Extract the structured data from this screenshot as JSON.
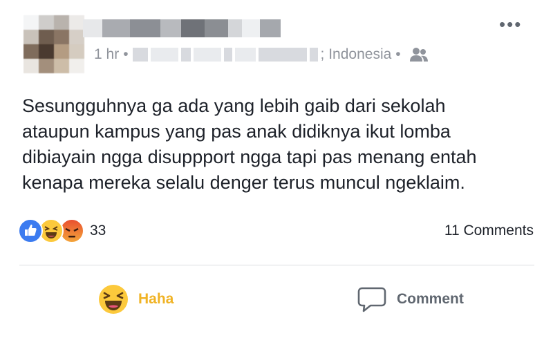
{
  "post": {
    "time": "1 hr",
    "location_suffix": "; Indonesia",
    "separator": "•",
    "menu": "•••",
    "audience_icon": "friends-icon",
    "text_lines": [
      "Sesungguhnya ga ada yang lebih gaib dari sekolah",
      "ataupun kampus yang pas anak didiknya ikut lomba",
      "dibiayain ngga disuppport ngga tapi pas menang entah",
      "kenapa mereka selalu denger terus muncul ngeklaim."
    ]
  },
  "reactions": {
    "icons": [
      "like-icon",
      "haha-icon",
      "angry-icon"
    ],
    "count": "33",
    "comments": "11 Comments"
  },
  "actions": {
    "haha_label": "Haha",
    "comment_label": "Comment"
  },
  "colors": {
    "like": "#3b7bf0",
    "haha": "#fcc93c",
    "haha_text": "#f0b325",
    "meta_text": "#90949c"
  }
}
